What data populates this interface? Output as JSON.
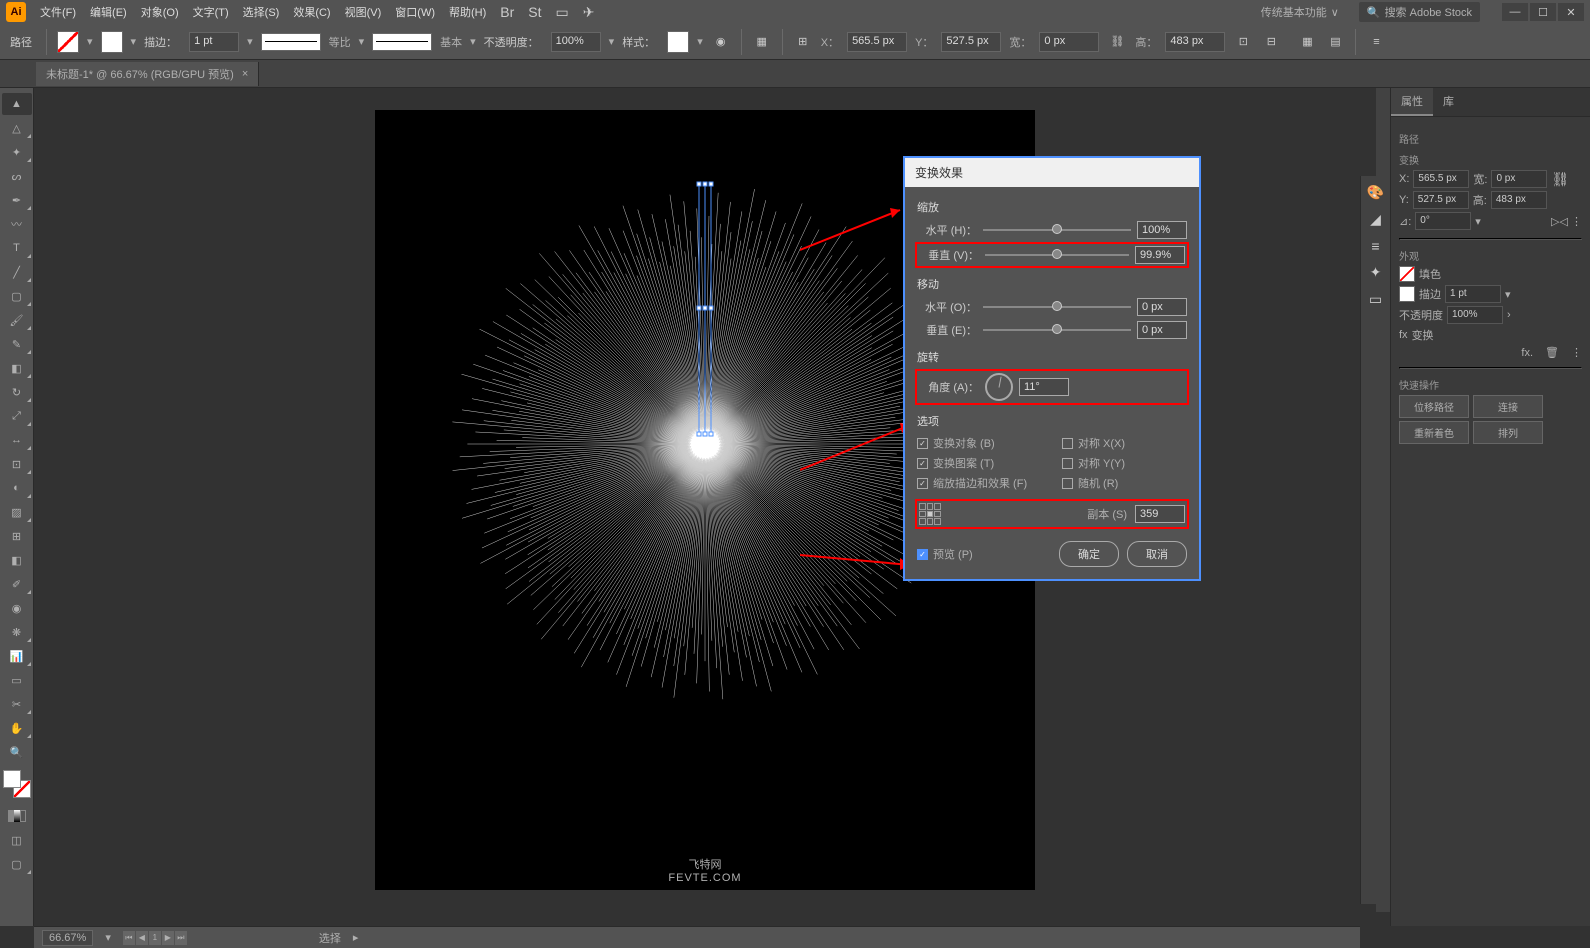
{
  "menubar": {
    "items": [
      "文件(F)",
      "编辑(E)",
      "对象(O)",
      "文字(T)",
      "选择(S)",
      "效果(C)",
      "视图(V)",
      "窗口(W)",
      "帮助(H)"
    ],
    "workspace_label": "传统基本功能",
    "search_placeholder": "搜索 Adobe Stock"
  },
  "controlbar": {
    "mode": "路径",
    "stroke_label": "描边：",
    "stroke_width": "1 pt",
    "uniform_label": "等比",
    "basic_label": "基本",
    "opacity_label": "不透明度：",
    "opacity_value": "100%",
    "style_label": "样式：",
    "x_label": "X：",
    "x_value": "565.5 px",
    "y_label": "Y：",
    "y_value": "527.5 px",
    "w_label": "宽：",
    "w_value": "0 px",
    "h_label": "高：",
    "h_value": "483 px"
  },
  "doctab": {
    "title": "未标题-1* @ 66.67% (RGB/GPU 预览)"
  },
  "watermark": {
    "cn": "飞特网",
    "site": "FEVTE.COM"
  },
  "dialog": {
    "title": "变换效果",
    "scale_title": "缩放",
    "horiz_label": "水平 (H)：",
    "horiz_value": "100%",
    "vert_label": "垂直 (V)：",
    "vert_value": "99.9%",
    "move_title": "移动",
    "move_h_label": "水平 (O)：",
    "move_h_value": "0 px",
    "move_v_label": "垂直 (E)：",
    "move_v_value": "0 px",
    "rotate_title": "旋转",
    "angle_label": "角度 (A)：",
    "angle_value": "11°",
    "options_title": "选项",
    "opt_transform_obj": "变换对象 (B)",
    "opt_mirror_x": "对称 X(X)",
    "opt_transform_pat": "变换图案 (T)",
    "opt_mirror_y": "对称 Y(Y)",
    "opt_scale_stroke": "缩放描边和效果 (F)",
    "opt_random": "随机 (R)",
    "copies_label": "副本 (S)",
    "copies_value": "359",
    "preview_label": "预览 (P)",
    "ok": "确定",
    "cancel": "取消"
  },
  "properties": {
    "tab1": "属性",
    "tab2": "库",
    "path_label": "路径",
    "transform_title": "变换",
    "x": "565.5 px",
    "y": "527.5 px",
    "w": "0 px",
    "h": "483 px",
    "angle": "0°",
    "appearance_title": "外观",
    "fill_label": "填色",
    "stroke_label": "描边",
    "stroke_val": "1 pt",
    "opacity_label": "不透明度",
    "opacity_val": "100%",
    "effect_transform": "变换",
    "quick_title": "快速操作",
    "btn_offset": "位移路径",
    "btn_join": "连接",
    "btn_recolor": "重新着色",
    "btn_arrange": "排列"
  },
  "statusbar": {
    "zoom": "66.67%",
    "mode": "选择"
  }
}
